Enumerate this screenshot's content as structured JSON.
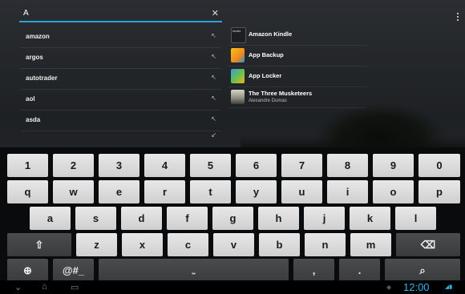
{
  "search": {
    "query": "A",
    "clear_icon": "close-icon"
  },
  "menu_icon": "overflow-menu-icon",
  "suggestions": [
    {
      "label": "amazon"
    },
    {
      "label": "argos"
    },
    {
      "label": "autotrader"
    },
    {
      "label": "aol"
    },
    {
      "label": "asda"
    }
  ],
  "apps": [
    {
      "name": "Amazon Kindle",
      "icon": "kindle-icon"
    },
    {
      "name": "App Backup",
      "icon": "app-backup-icon"
    },
    {
      "name": "App Locker",
      "icon": "app-locker-icon"
    },
    {
      "name": "The Three Musketeers",
      "subtitle": "Alexandre Dumas",
      "icon": "book-cover-icon"
    }
  ],
  "keyboard": {
    "row1": [
      "1",
      "2",
      "3",
      "4",
      "5",
      "6",
      "7",
      "8",
      "9",
      "0"
    ],
    "row2": [
      "q",
      "w",
      "e",
      "r",
      "t",
      "y",
      "u",
      "i",
      "o",
      "p"
    ],
    "row3": [
      "a",
      "s",
      "d",
      "f",
      "g",
      "h",
      "j",
      "k",
      "l"
    ],
    "row4": [
      "z",
      "x",
      "c",
      "v",
      "b",
      "n",
      "m"
    ],
    "shift_glyph": "⇧",
    "backspace_glyph": "⌫",
    "globe_glyph": "⊕",
    "symbols_label": "@#_",
    "space_glyph": "⎵",
    "comma_label": ",",
    "period_label": ".",
    "search_glyph": "⌕"
  },
  "status": {
    "clock": "12:00"
  },
  "colors": {
    "accent": "#2ba3d8",
    "keyboard_bg": "#0a0b0c"
  }
}
